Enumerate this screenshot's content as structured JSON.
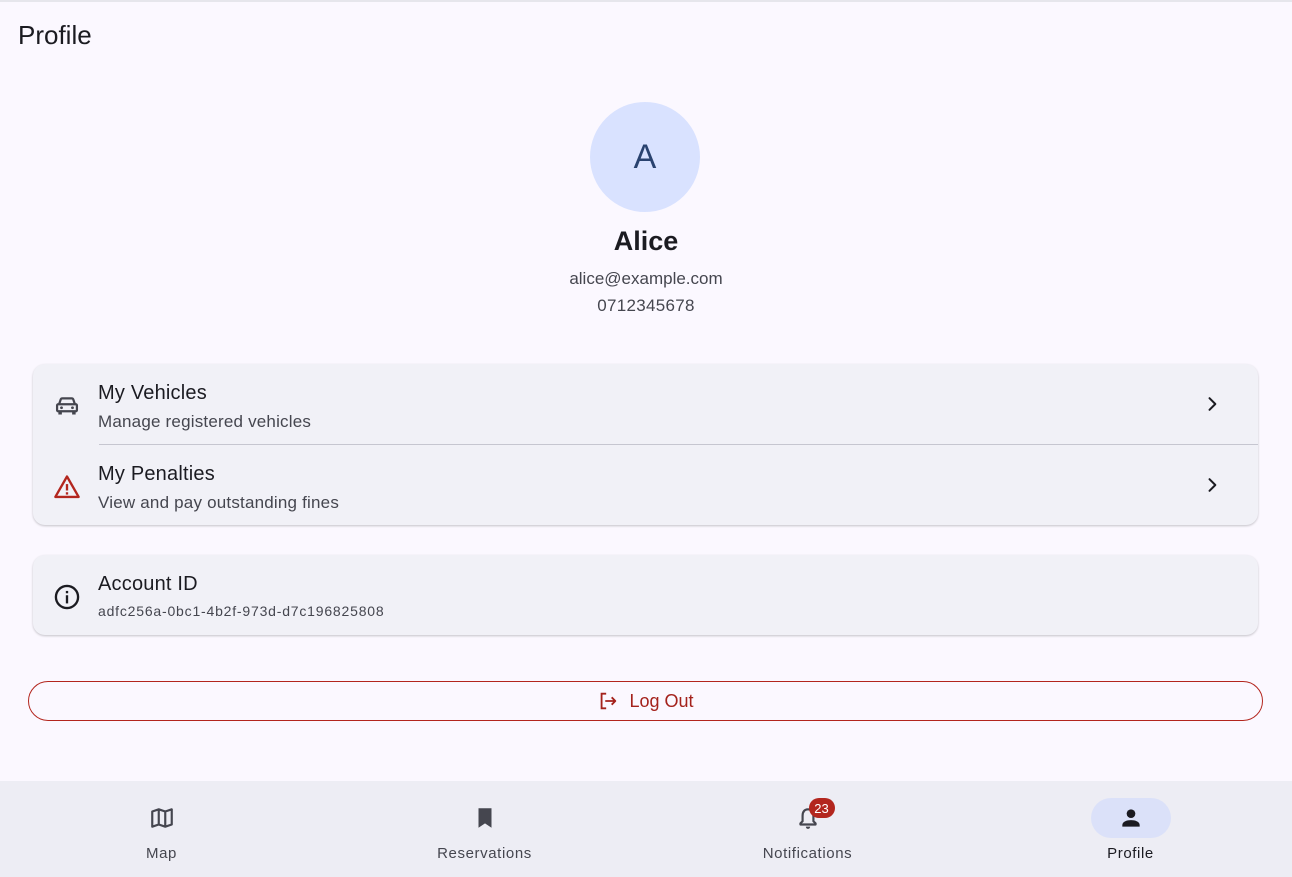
{
  "app_title": "Profile",
  "profile": {
    "avatar_initial": "A",
    "name": "Alice",
    "email": "alice@example.com",
    "phone": "0712345678"
  },
  "menu": {
    "vehicles": {
      "title": "My Vehicles",
      "subtitle": "Manage registered vehicles",
      "icon": "car-icon"
    },
    "penalties": {
      "title": "My Penalties",
      "subtitle": "View and pay outstanding fines",
      "icon": "warning-icon"
    }
  },
  "account": {
    "title": "Account ID",
    "id": "adfc256a-0bc1-4b2f-973d-d7c196825808",
    "icon": "info-icon"
  },
  "logout": {
    "label": "Log Out",
    "icon": "logout-icon"
  },
  "nav": {
    "map": {
      "label": "Map",
      "icon": "map-icon"
    },
    "reservations": {
      "label": "Reservations",
      "icon": "bookmark-icon"
    },
    "notifications": {
      "label": "Notifications",
      "icon": "bell-icon",
      "badge": "23"
    },
    "profile": {
      "label": "Profile",
      "icon": "person-icon",
      "active": true
    }
  },
  "colors": {
    "background": "#fbf8ff",
    "card": "#f1f1f7",
    "avatar_bg": "#d9e2ff",
    "danger": "#b3261e",
    "nav_bg": "#ededf4",
    "nav_active_pill": "#dbe1f9"
  }
}
